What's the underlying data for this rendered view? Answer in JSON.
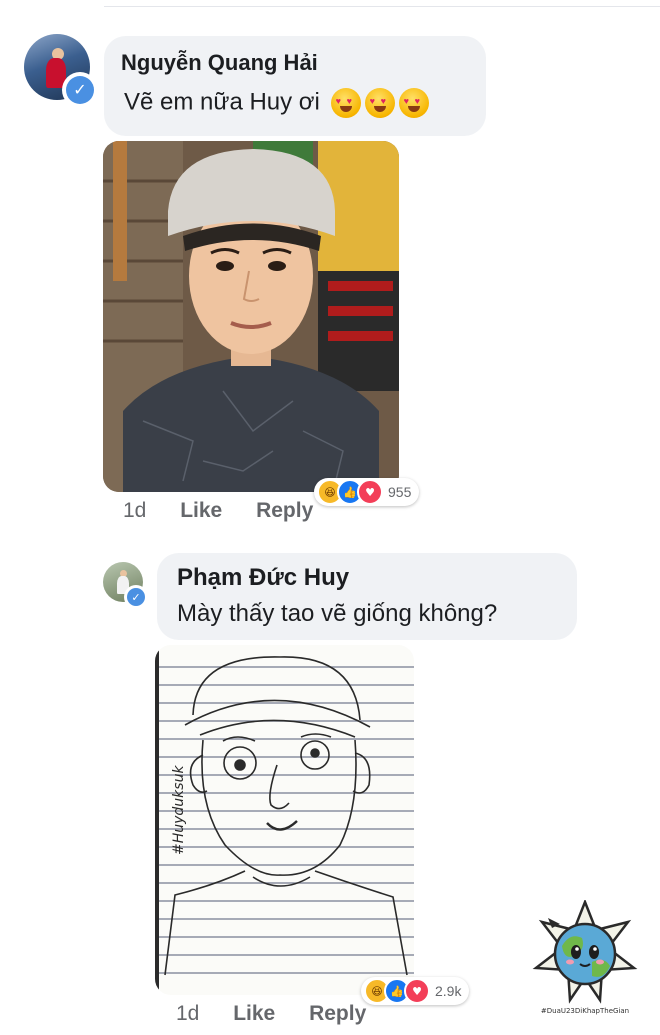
{
  "comments": [
    {
      "author": "Nguyễn Quang Hải",
      "text": "Vẽ em nữa Huy ơi",
      "emojis": [
        "heart-eyes-emoji",
        "heart-eyes-emoji",
        "heart-eyes-emoji"
      ],
      "time": "1d",
      "like_label": "Like",
      "reply_label": "Reply",
      "reaction_count": "955",
      "reactions": [
        "haha",
        "like",
        "love"
      ]
    },
    {
      "author": "Phạm Đức Huy",
      "text": "Mày thấy tao vẽ giống không?",
      "time": "1d",
      "like_label": "Like",
      "reply_label": "Reply",
      "reaction_count": "2.9k",
      "reactions": [
        "haha",
        "like",
        "love"
      ],
      "sketch_signature": "#Huyduksuk"
    }
  ],
  "watermark": {
    "text": "#DuaU23DiKhapTheGian"
  },
  "colors": {
    "bubble": "#f0f2f5",
    "meta_text": "#65676b",
    "verified": "#4a90e2",
    "like": "#1877f2",
    "love": "#f33e58",
    "haha": "#f7b928"
  }
}
